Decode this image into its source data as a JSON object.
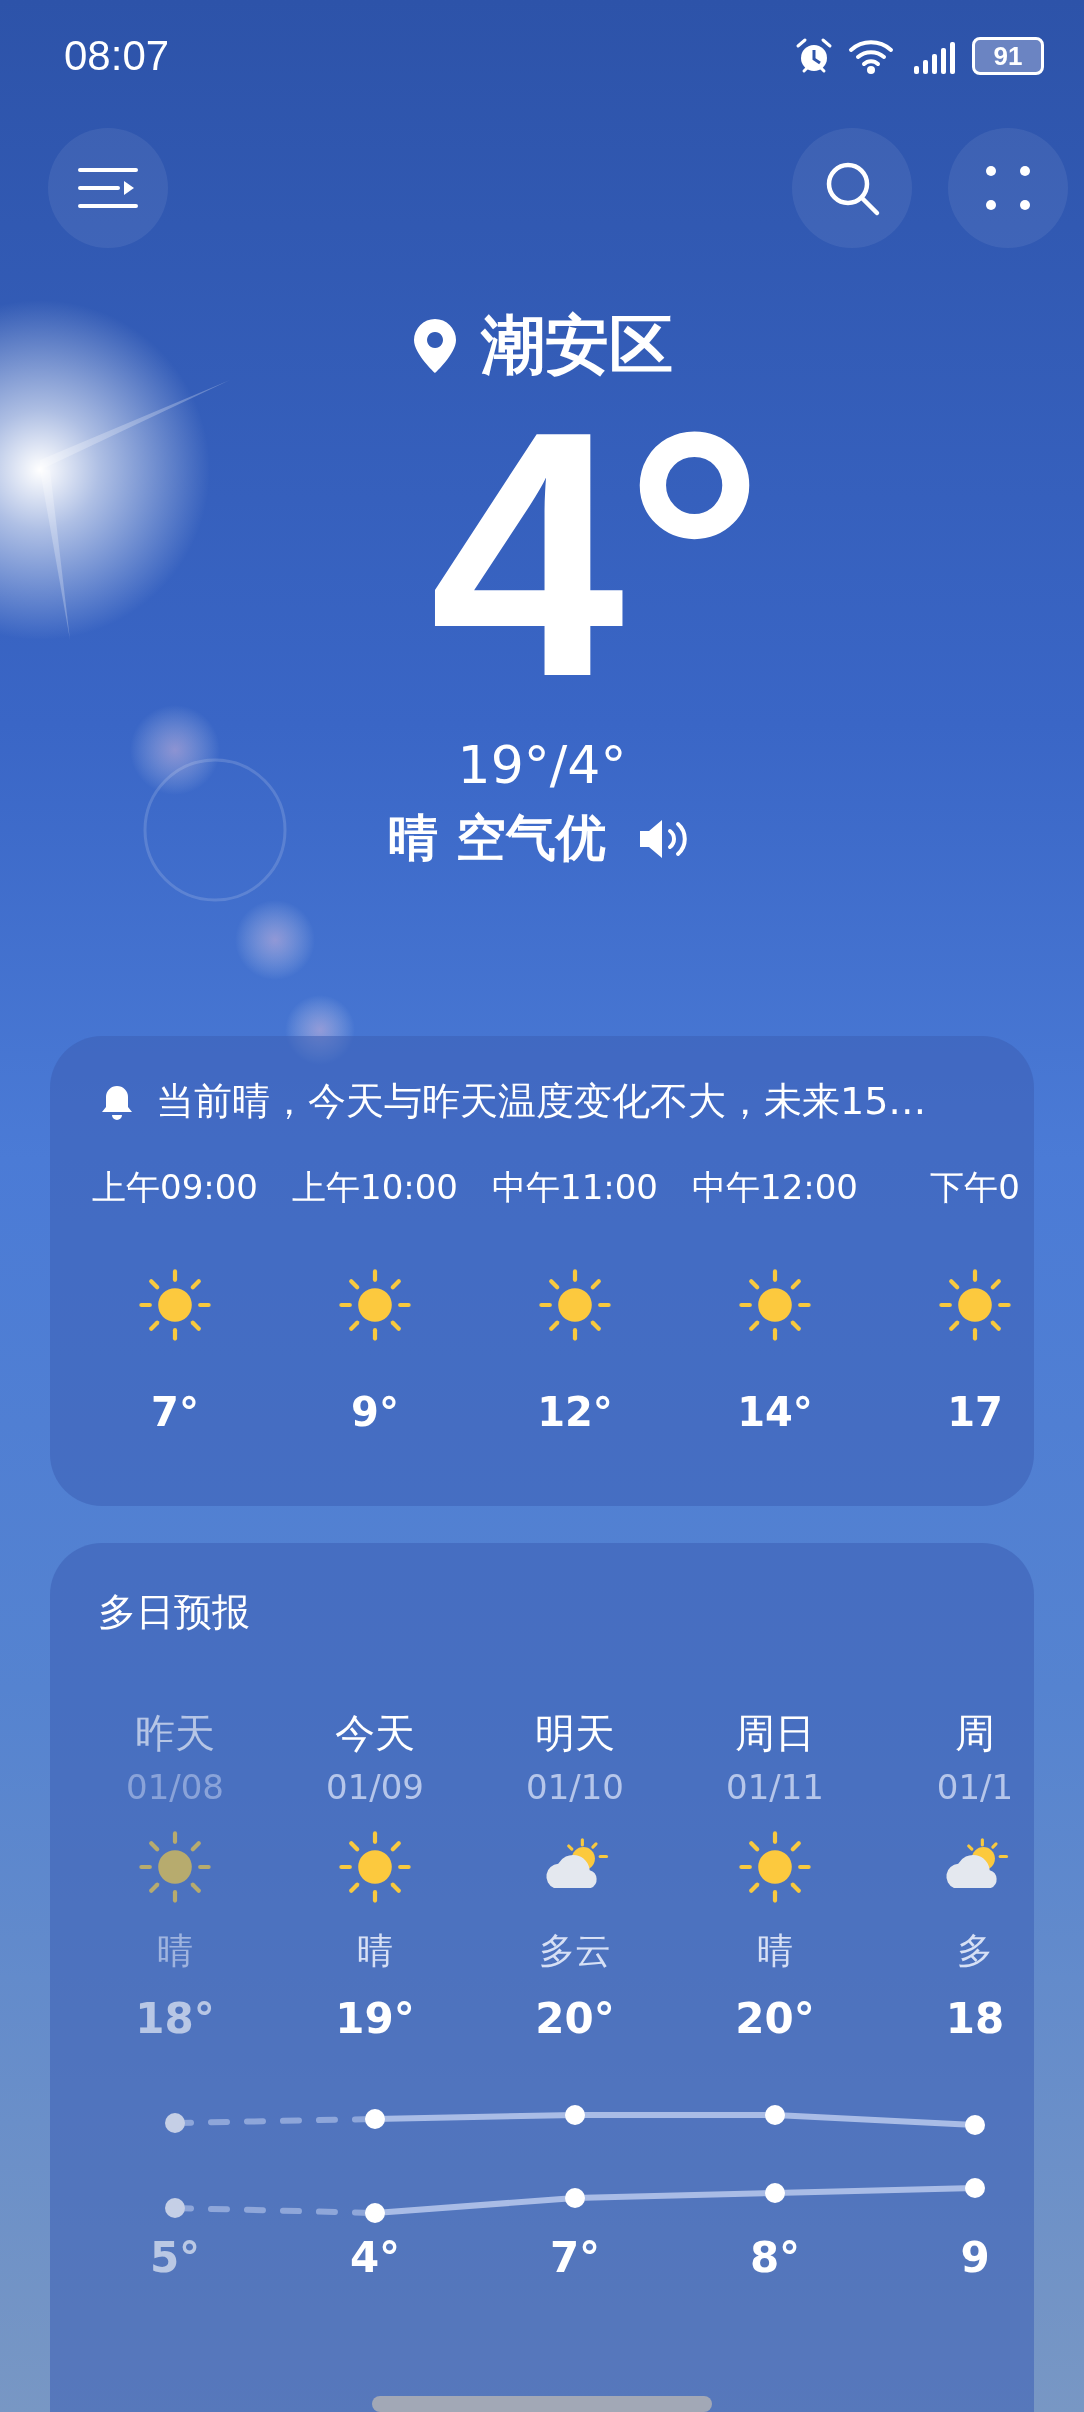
{
  "status_bar": {
    "time": "08:07",
    "battery": "91"
  },
  "location": "潮安区",
  "current_temp": "4°",
  "range": "19°/4°",
  "condition": "晴 空气优",
  "hourly": {
    "alert": "当前晴，今天与昨天温度变化不大，未来15…",
    "hours": [
      {
        "time": "上午09:00",
        "kind": "sunny",
        "temp": "7°"
      },
      {
        "time": "上午10:00",
        "kind": "sunny",
        "temp": "9°"
      },
      {
        "time": "中午11:00",
        "kind": "sunny",
        "temp": "12°"
      },
      {
        "time": "中午12:00",
        "kind": "sunny",
        "temp": "14°"
      },
      {
        "time": "下午0",
        "kind": "sunny",
        "temp": "17"
      }
    ]
  },
  "daily": {
    "title": "多日预报",
    "days": [
      {
        "day": "昨天",
        "date": "01/08",
        "kind": "sunny",
        "weather": "晴",
        "high": "18°",
        "low": "5°",
        "past": true
      },
      {
        "day": "今天",
        "date": "01/09",
        "kind": "sunny",
        "weather": "晴",
        "high": "19°",
        "low": "4°",
        "past": false
      },
      {
        "day": "明天",
        "date": "01/10",
        "kind": "partly_cloudy",
        "weather": "多云",
        "high": "20°",
        "low": "7°",
        "past": false
      },
      {
        "day": "周日",
        "date": "01/11",
        "kind": "sunny",
        "weather": "晴",
        "high": "20°",
        "low": "8°",
        "past": false
      },
      {
        "day": "周",
        "date": "01/1",
        "kind": "partly_cloudy",
        "weather": "多",
        "high": "18",
        "low": "9",
        "past": false
      }
    ]
  }
}
